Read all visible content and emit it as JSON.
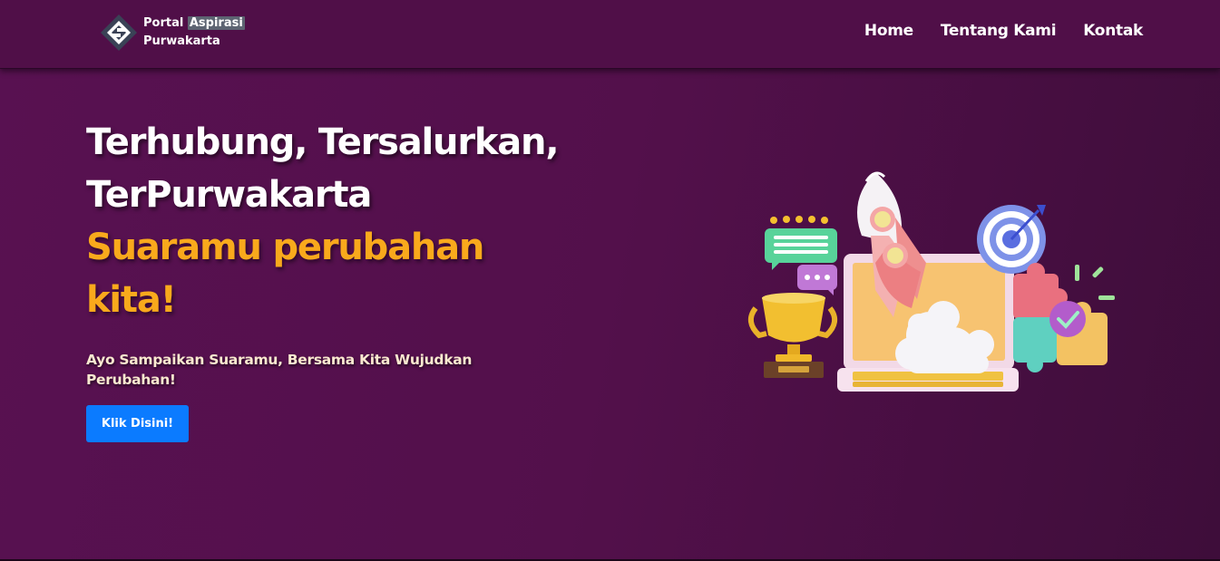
{
  "navbar": {
    "brand": {
      "line1_prefix": "Portal",
      "line1_highlight": "Aspirasi",
      "line2": "Purwakarta"
    },
    "links": [
      {
        "label": "Home"
      },
      {
        "label": "Tentang Kami"
      },
      {
        "label": "Kontak"
      }
    ]
  },
  "hero": {
    "title_line1": "Terhubung, Tersalurkan,",
    "title_line2": "TerPurwakarta",
    "tagline": "Suaramu perubahan kita!",
    "subtitle": "Ayo Sampaikan Suaramu, Bersama Kita Wujudkan Perubahan!",
    "cta_label": "Klik Disini!"
  },
  "colors": {
    "background": "#520f4a",
    "accent_yellow": "#f9a91c",
    "button_blue": "#0b7bff"
  },
  "icons": {
    "brand": "portal-logo-icon",
    "illustration": "rocket-laptop-illustration"
  }
}
